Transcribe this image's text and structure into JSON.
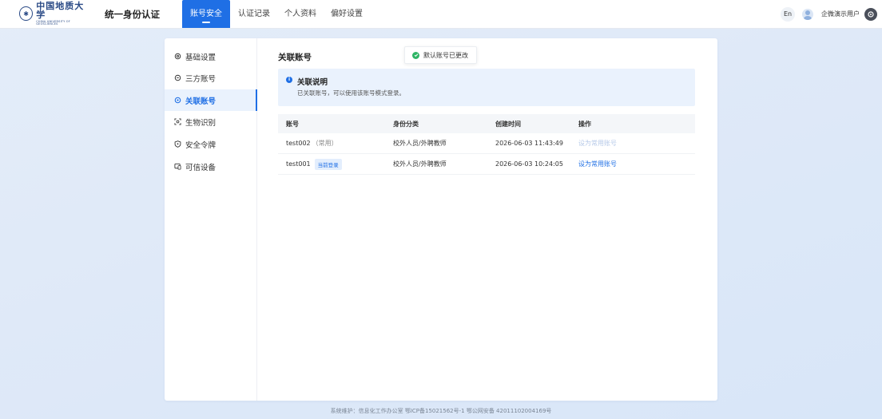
{
  "header": {
    "logo_cn": "中国地质大学",
    "logo_en": "CHINA UNIVERSITY OF GEOSCIENCES",
    "system_title": "统一身份认证",
    "nav": [
      {
        "label": "账号安全",
        "active": true
      },
      {
        "label": "认证记录",
        "active": false
      },
      {
        "label": "个人资料",
        "active": false
      },
      {
        "label": "偏好设置",
        "active": false
      }
    ],
    "lang_label": "En",
    "user_name": "企微演示用户"
  },
  "sidebar": {
    "items": [
      {
        "label": "基础设置",
        "icon": "gear-icon"
      },
      {
        "label": "三方账号",
        "icon": "link-gear-icon"
      },
      {
        "label": "关联账号",
        "icon": "link-icon",
        "active": true
      },
      {
        "label": "生物识别",
        "icon": "face-scan-icon"
      },
      {
        "label": "安全令牌",
        "icon": "shield-icon"
      },
      {
        "label": "可信设备",
        "icon": "device-icon"
      }
    ]
  },
  "main": {
    "title": "关联账号",
    "toast": "默认账号已更改",
    "notice": {
      "title": "关联说明",
      "desc": "已关联账号，可以使用该账号模式登录。"
    },
    "table": {
      "headers": [
        "账号",
        "身份分类",
        "创建时间",
        "操作"
      ],
      "rows": [
        {
          "account": "test002",
          "sub": "（常用）",
          "tag": "",
          "category": "校外人员/外聘教师",
          "created": "2026-06-03 11:43:49",
          "action": "设为常用账号",
          "action_enabled": false
        },
        {
          "account": "test001",
          "sub": "",
          "tag": "当前登录",
          "category": "校外人员/外聘教师",
          "created": "2026-06-03 10:24:05",
          "action": "设为常用账号",
          "action_enabled": true
        }
      ]
    }
  },
  "footer": {
    "text": "系统维护：信息化工作办公室 鄂ICP备15021562号-1 鄂公网安备 42011102004169号"
  },
  "colors": {
    "accent": "#1f6fe5",
    "success": "#2eb565"
  }
}
